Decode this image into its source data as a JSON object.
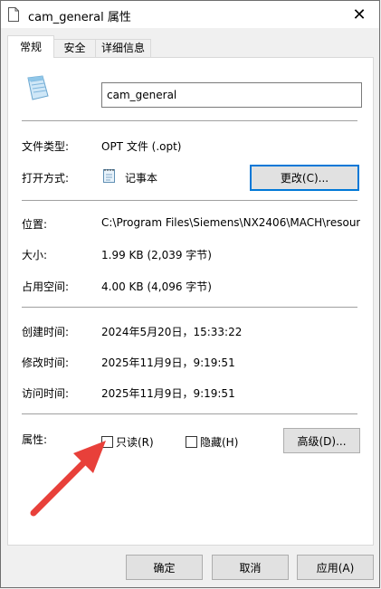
{
  "window": {
    "title": "cam_general 属性"
  },
  "tabs": [
    {
      "label": "常规"
    },
    {
      "label": "安全"
    },
    {
      "label": "详细信息"
    }
  ],
  "general": {
    "file_name": "cam_general",
    "file_type": {
      "label": "文件类型:",
      "value": "OPT 文件 (.opt)"
    },
    "opens_with": {
      "label": "打开方式:",
      "value": "记事本",
      "change_button": "更改(C)..."
    },
    "location": {
      "label": "位置:",
      "value": "C:\\Program Files\\Siemens\\NX2406\\MACH\\resour"
    },
    "size": {
      "label": "大小:",
      "value": "1.99 KB (2,039 字节)"
    },
    "size_on_disk": {
      "label": "占用空间:",
      "value": "4.00 KB (4,096 字节)"
    },
    "created": {
      "label": "创建时间:",
      "value": "2024年5月20日，15:33:22"
    },
    "modified": {
      "label": "修改时间:",
      "value": "2025年11月9日，9:19:51"
    },
    "accessed": {
      "label": "访问时间:",
      "value": "2025年11月9日，9:19:51"
    },
    "attributes": {
      "label": "属性:",
      "readonly": "只读(R)",
      "hidden": "隐藏(H)",
      "advanced_button": "高级(D)..."
    }
  },
  "footer": {
    "ok": "确定",
    "cancel": "取消",
    "apply": "应用(A)"
  },
  "colors": {
    "annotation_arrow": "#e8403a",
    "focus_border": "#0078d7"
  }
}
